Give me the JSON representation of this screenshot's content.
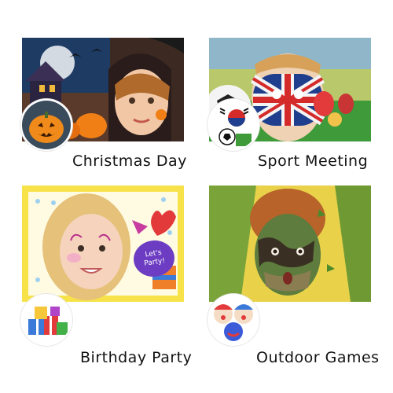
{
  "captions": {
    "christmas": "Christmas Day",
    "sport": "Sport Meeting",
    "birthday": "Birthday Party",
    "outdoor": "Outdoor Games"
  },
  "stickers": {
    "party_bubble": "Let's Party!"
  },
  "colors": {
    "background": "#ffffff",
    "caption_text": "#111111",
    "halloween_sky": "#1d3b63",
    "halloween_orange": "#f07f15",
    "sport_grass": "#3f9a3a",
    "party_yellow": "#f7e24a",
    "camo_green": "#5d7c3d"
  },
  "icons": {
    "christmas_badge": "pumpkin-icon",
    "sport_badge": "flag-soccer-icon",
    "birthday_badge": "gift-boxes-icon",
    "outdoor_badge": "clown-faces-icon"
  }
}
